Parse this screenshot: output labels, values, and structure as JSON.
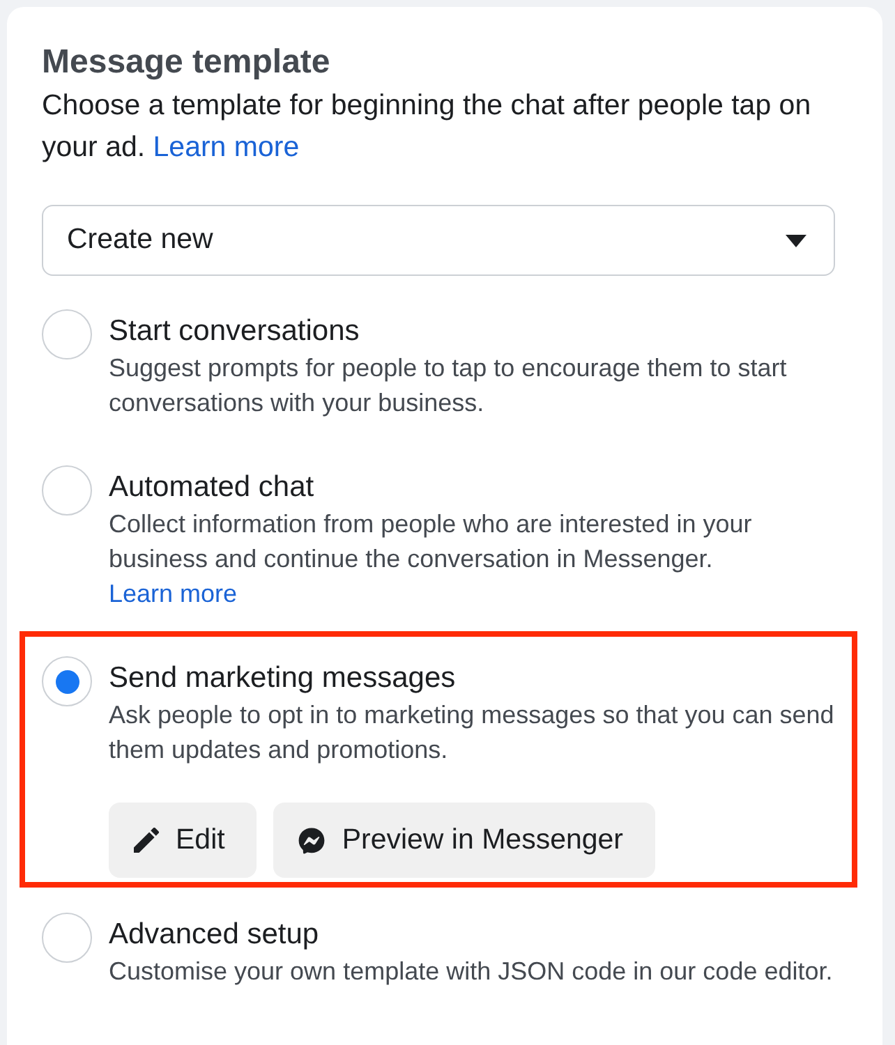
{
  "card": {
    "title": "Message template",
    "description": "Choose a template for beginning the chat after people tap on your ad.",
    "description_link": "Learn more"
  },
  "template_select": {
    "value": "Create new"
  },
  "options": [
    {
      "label": "Start conversations",
      "description": "Suggest prompts for people to tap to encourage them to start conversations with your business.",
      "selected": false,
      "highlighted": false
    },
    {
      "label": "Automated chat",
      "description": "Collect information from people who are interested in your business and continue the conversation in Messenger.",
      "link": "Learn more",
      "selected": false,
      "highlighted": false
    },
    {
      "label": "Send marketing messages",
      "description": "Ask people to opt in to marketing messages so that you can send them updates and promotions.",
      "selected": true,
      "highlighted": true,
      "actions": [
        {
          "kind": "edit",
          "label": "Edit"
        },
        {
          "kind": "preview",
          "label": "Preview in Messenger"
        }
      ]
    },
    {
      "label": "Advanced setup",
      "description": "Customise your own template with JSON code in our code editor.",
      "selected": false,
      "highlighted": false
    }
  ]
}
